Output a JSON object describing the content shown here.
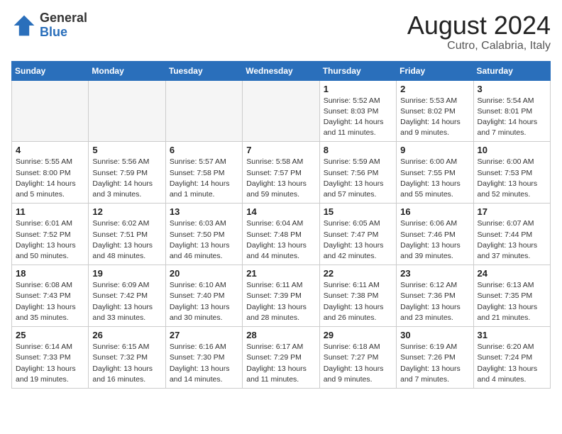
{
  "header": {
    "logo_general": "General",
    "logo_blue": "Blue",
    "month_year": "August 2024",
    "location": "Cutro, Calabria, Italy"
  },
  "weekdays": [
    "Sunday",
    "Monday",
    "Tuesday",
    "Wednesday",
    "Thursday",
    "Friday",
    "Saturday"
  ],
  "weeks": [
    [
      {
        "day": "",
        "info": ""
      },
      {
        "day": "",
        "info": ""
      },
      {
        "day": "",
        "info": ""
      },
      {
        "day": "",
        "info": ""
      },
      {
        "day": "1",
        "info": "Sunrise: 5:52 AM\nSunset: 8:03 PM\nDaylight: 14 hours\nand 11 minutes."
      },
      {
        "day": "2",
        "info": "Sunrise: 5:53 AM\nSunset: 8:02 PM\nDaylight: 14 hours\nand 9 minutes."
      },
      {
        "day": "3",
        "info": "Sunrise: 5:54 AM\nSunset: 8:01 PM\nDaylight: 14 hours\nand 7 minutes."
      }
    ],
    [
      {
        "day": "4",
        "info": "Sunrise: 5:55 AM\nSunset: 8:00 PM\nDaylight: 14 hours\nand 5 minutes."
      },
      {
        "day": "5",
        "info": "Sunrise: 5:56 AM\nSunset: 7:59 PM\nDaylight: 14 hours\nand 3 minutes."
      },
      {
        "day": "6",
        "info": "Sunrise: 5:57 AM\nSunset: 7:58 PM\nDaylight: 14 hours\nand 1 minute."
      },
      {
        "day": "7",
        "info": "Sunrise: 5:58 AM\nSunset: 7:57 PM\nDaylight: 13 hours\nand 59 minutes."
      },
      {
        "day": "8",
        "info": "Sunrise: 5:59 AM\nSunset: 7:56 PM\nDaylight: 13 hours\nand 57 minutes."
      },
      {
        "day": "9",
        "info": "Sunrise: 6:00 AM\nSunset: 7:55 PM\nDaylight: 13 hours\nand 55 minutes."
      },
      {
        "day": "10",
        "info": "Sunrise: 6:00 AM\nSunset: 7:53 PM\nDaylight: 13 hours\nand 52 minutes."
      }
    ],
    [
      {
        "day": "11",
        "info": "Sunrise: 6:01 AM\nSunset: 7:52 PM\nDaylight: 13 hours\nand 50 minutes."
      },
      {
        "day": "12",
        "info": "Sunrise: 6:02 AM\nSunset: 7:51 PM\nDaylight: 13 hours\nand 48 minutes."
      },
      {
        "day": "13",
        "info": "Sunrise: 6:03 AM\nSunset: 7:50 PM\nDaylight: 13 hours\nand 46 minutes."
      },
      {
        "day": "14",
        "info": "Sunrise: 6:04 AM\nSunset: 7:48 PM\nDaylight: 13 hours\nand 44 minutes."
      },
      {
        "day": "15",
        "info": "Sunrise: 6:05 AM\nSunset: 7:47 PM\nDaylight: 13 hours\nand 42 minutes."
      },
      {
        "day": "16",
        "info": "Sunrise: 6:06 AM\nSunset: 7:46 PM\nDaylight: 13 hours\nand 39 minutes."
      },
      {
        "day": "17",
        "info": "Sunrise: 6:07 AM\nSunset: 7:44 PM\nDaylight: 13 hours\nand 37 minutes."
      }
    ],
    [
      {
        "day": "18",
        "info": "Sunrise: 6:08 AM\nSunset: 7:43 PM\nDaylight: 13 hours\nand 35 minutes."
      },
      {
        "day": "19",
        "info": "Sunrise: 6:09 AM\nSunset: 7:42 PM\nDaylight: 13 hours\nand 33 minutes."
      },
      {
        "day": "20",
        "info": "Sunrise: 6:10 AM\nSunset: 7:40 PM\nDaylight: 13 hours\nand 30 minutes."
      },
      {
        "day": "21",
        "info": "Sunrise: 6:11 AM\nSunset: 7:39 PM\nDaylight: 13 hours\nand 28 minutes."
      },
      {
        "day": "22",
        "info": "Sunrise: 6:11 AM\nSunset: 7:38 PM\nDaylight: 13 hours\nand 26 minutes."
      },
      {
        "day": "23",
        "info": "Sunrise: 6:12 AM\nSunset: 7:36 PM\nDaylight: 13 hours\nand 23 minutes."
      },
      {
        "day": "24",
        "info": "Sunrise: 6:13 AM\nSunset: 7:35 PM\nDaylight: 13 hours\nand 21 minutes."
      }
    ],
    [
      {
        "day": "25",
        "info": "Sunrise: 6:14 AM\nSunset: 7:33 PM\nDaylight: 13 hours\nand 19 minutes."
      },
      {
        "day": "26",
        "info": "Sunrise: 6:15 AM\nSunset: 7:32 PM\nDaylight: 13 hours\nand 16 minutes."
      },
      {
        "day": "27",
        "info": "Sunrise: 6:16 AM\nSunset: 7:30 PM\nDaylight: 13 hours\nand 14 minutes."
      },
      {
        "day": "28",
        "info": "Sunrise: 6:17 AM\nSunset: 7:29 PM\nDaylight: 13 hours\nand 11 minutes."
      },
      {
        "day": "29",
        "info": "Sunrise: 6:18 AM\nSunset: 7:27 PM\nDaylight: 13 hours\nand 9 minutes."
      },
      {
        "day": "30",
        "info": "Sunrise: 6:19 AM\nSunset: 7:26 PM\nDaylight: 13 hours\nand 7 minutes."
      },
      {
        "day": "31",
        "info": "Sunrise: 6:20 AM\nSunset: 7:24 PM\nDaylight: 13 hours\nand 4 minutes."
      }
    ]
  ]
}
